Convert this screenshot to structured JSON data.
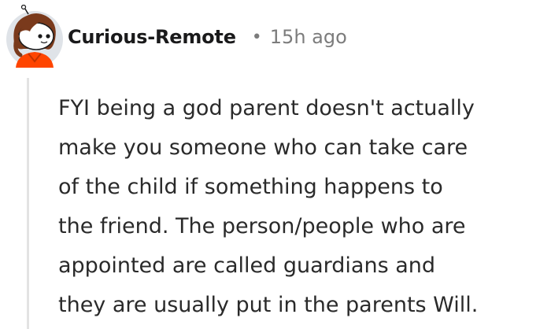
{
  "comment": {
    "author": "Curious-Remote",
    "separator": "•",
    "time": "15h ago",
    "avatar_icon": "snoo-avatar-icon",
    "body_lines": [
      "FYI being a god parent doesn't actually",
      "make you someone who can take care",
      "of the child if something happens to",
      "the friend. The person/people who are",
      "appointed are called guardians and",
      "they are usually put in the parents Will."
    ]
  },
  "colors": {
    "author": "#1a1a1b",
    "meta": "#7c7c7c",
    "body": "#2a2a2a",
    "thread_line": "#e3e3e3",
    "avatar_bg": "#dfe3e8",
    "avatar_shirt": "#ff4500",
    "avatar_hair": "#7a3a1c"
  }
}
